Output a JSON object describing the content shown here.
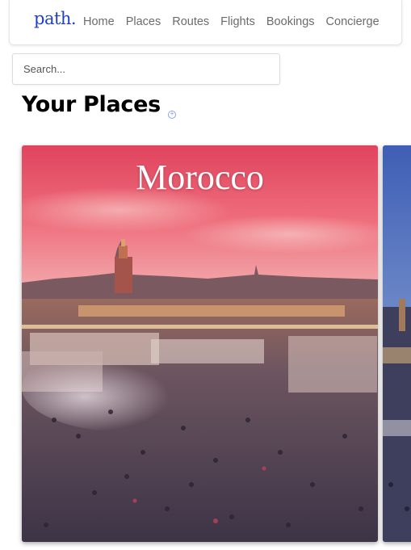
{
  "header": {
    "logo": "path.",
    "nav": [
      "Home",
      "Places",
      "Routes",
      "Flights",
      "Bookings",
      "Concierge"
    ]
  },
  "search": {
    "placeholder": "Search..."
  },
  "main": {
    "title": "Your Places",
    "add_icon": "plus-circle-icon",
    "cards": [
      {
        "title": "Morocco"
      },
      {
        "title": ""
      }
    ]
  },
  "colors": {
    "brand": "#1f3fc7",
    "nav_text": "#6b6b6b"
  }
}
